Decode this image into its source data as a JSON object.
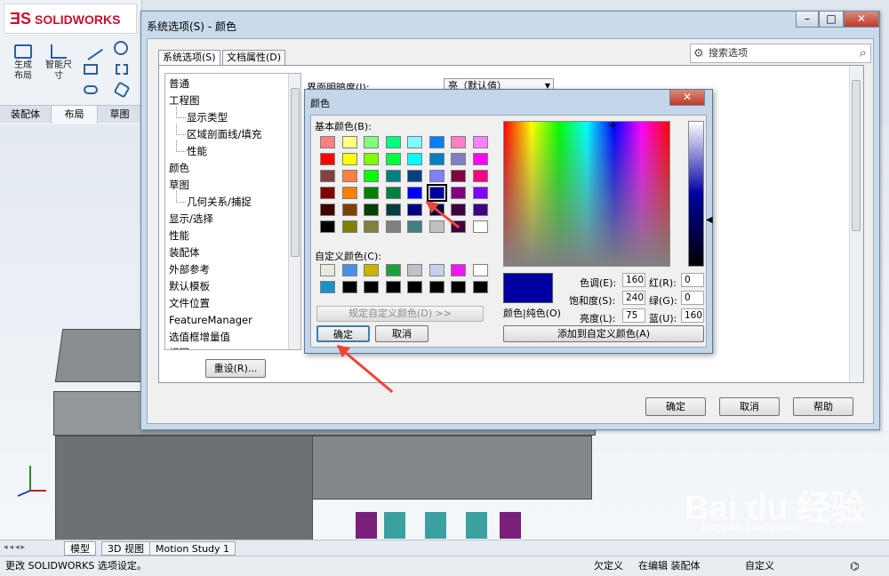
{
  "app": {
    "logo_text": "SOLIDWORKS",
    "toolbar_tools": [
      {
        "label": "生成\n布局"
      },
      {
        "label": "智能尺\n寸"
      }
    ],
    "left_tabs": [
      "装配体",
      "布局",
      "草图"
    ]
  },
  "system_dialog": {
    "title": "系统选项(S) - 颜色",
    "search_placeholder": "搜索选项",
    "tabs": [
      "系统选项(S)",
      "文档属性(D)"
    ],
    "tree": [
      {
        "label": "普通",
        "level": 0
      },
      {
        "label": "工程图",
        "level": 0
      },
      {
        "label": "显示类型",
        "level": 1
      },
      {
        "label": "区域剖面线/填充",
        "level": 1
      },
      {
        "label": "性能",
        "level": 1
      },
      {
        "label": "颜色",
        "level": 0
      },
      {
        "label": "草图",
        "level": 0
      },
      {
        "label": "几何关系/捕捉",
        "level": 1
      },
      {
        "label": "显示/选择",
        "level": 0
      },
      {
        "label": "性能",
        "level": 0
      },
      {
        "label": "装配体",
        "level": 0
      },
      {
        "label": "外部参考",
        "level": 0
      },
      {
        "label": "默认模板",
        "level": 0
      },
      {
        "label": "文件位置",
        "level": 0
      },
      {
        "label": "FeatureManager",
        "level": 0
      },
      {
        "label": "选值框增量值",
        "level": 0
      },
      {
        "label": "视图",
        "level": 0
      }
    ],
    "brightness_label": "界面明暗度(I):",
    "brightness_value": "亮（默认值）",
    "reset_button": "重设(R)...",
    "ok_button": "确定",
    "cancel_button": "取消",
    "help_button": "帮助"
  },
  "color_dialog": {
    "title": "颜色",
    "basic_colors_label": "基本颜色(B):",
    "basic_colors": [
      "#ff8080",
      "#ffff80",
      "#80ff80",
      "#00ff80",
      "#80ffff",
      "#0080ff",
      "#ff80c0",
      "#ff80ff",
      "#ff0000",
      "#ffff00",
      "#80ff00",
      "#00ff40",
      "#00ffff",
      "#0080c0",
      "#8080c0",
      "#ff00ff",
      "#804040",
      "#ff8040",
      "#00ff00",
      "#008080",
      "#004080",
      "#8080ff",
      "#800040",
      "#ff0080",
      "#800000",
      "#ff8000",
      "#008000",
      "#008040",
      "#0000ff",
      "#0000a0",
      "#800080",
      "#8000ff",
      "#400000",
      "#804000",
      "#004000",
      "#004040",
      "#000080",
      "#000040",
      "#400040",
      "#400080",
      "#000000",
      "#808000",
      "#808040",
      "#808080",
      "#408080",
      "#c0c0c0",
      "#400040",
      "#ffffff"
    ],
    "selected_index": 29,
    "custom_colors_label": "自定义颜色(C):",
    "custom_colors": [
      "#e8e8e0",
      "#4a90e8",
      "#c8b400",
      "#1fa040",
      "#c0c0c8",
      "#c8d0f0",
      "#f018f0",
      "#ffffff",
      "#1890c8",
      "#000000",
      "#000000",
      "#000000",
      "#000000",
      "#000000",
      "#000000",
      "#000000"
    ],
    "define_custom_button": "规定自定义颜色(D) >>",
    "ok_button": "确定",
    "cancel_button": "取消",
    "solid_label": "颜色|纯色(O)",
    "add_custom_button": "添加到自定义颜色(A)",
    "fields": {
      "hue_label": "色调(E):",
      "hue": "160",
      "sat_label": "饱和度(S):",
      "sat": "240",
      "lum_label": "亮度(L):",
      "lum": "75",
      "red_label": "红(R):",
      "red": "0",
      "green_label": "绿(G):",
      "green": "0",
      "blue_label": "蓝(U):",
      "blue": "160"
    },
    "preview_color": "#0000a0"
  },
  "bottom_tabs": [
    "模型",
    "3D 视图",
    "Motion Study 1"
  ],
  "status": {
    "message": "更改 SOLIDWORKS 选项设定。",
    "underdefined": "欠定义",
    "editing": "在编辑 装配体",
    "custom": "自定义"
  },
  "watermark": {
    "brand": "Bai du 经验",
    "url": "jingyan.baidu.com"
  }
}
